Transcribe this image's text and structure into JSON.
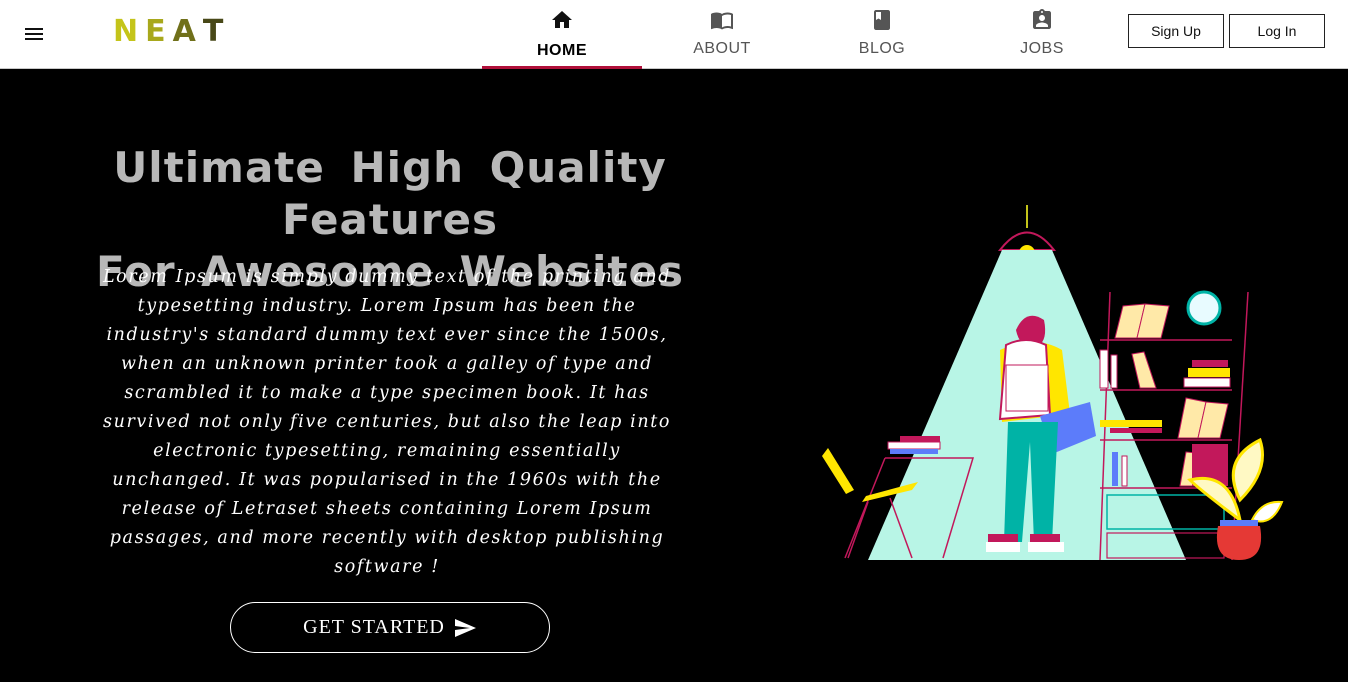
{
  "header": {
    "menu_icon": "hamburger-menu-icon",
    "logo": {
      "letters": [
        "N",
        "E",
        "A",
        "T"
      ],
      "colors": [
        "#c4c41a",
        "#a8a81c",
        "#70701a",
        "#484818"
      ]
    },
    "nav": [
      {
        "label": "HOME",
        "icon": "home-icon",
        "active": true
      },
      {
        "label": "ABOUT",
        "icon": "book-open-icon",
        "active": false
      },
      {
        "label": "BLOG",
        "icon": "book-icon",
        "active": false
      },
      {
        "label": "JOBS",
        "icon": "contact-card-icon",
        "active": false
      }
    ],
    "active_color": "#b0103a",
    "signup_label": "Sign Up",
    "login_label": "Log In"
  },
  "hero": {
    "title_line1": "Ultimate High Quality Features",
    "title_line2": "For Awesome Websites",
    "body": "Lorem Ipsum is simply dummy text of the printing and typesetting industry. Lorem Ipsum has been the industry's standard dummy text ever since the 1500s, when an unknown printer took a galley of type and scrambled it to make a type specimen book. It has survived not only five centuries, but also the leap into electronic typesetting, remaining essentially unchanged. It was popularised in the 1960s with the release of Letraset sheets containing Lorem Ipsum passages, and more recently with desktop publishing software !",
    "cta_label": "GET STARTED",
    "cta_icon": "send-icon"
  },
  "illustration": {
    "subject": "student-library-illustration",
    "colors": {
      "light": "#b8f5e6",
      "accent": "#c2185b",
      "yellow": "#ffe600",
      "teal": "#00b3a6"
    }
  }
}
